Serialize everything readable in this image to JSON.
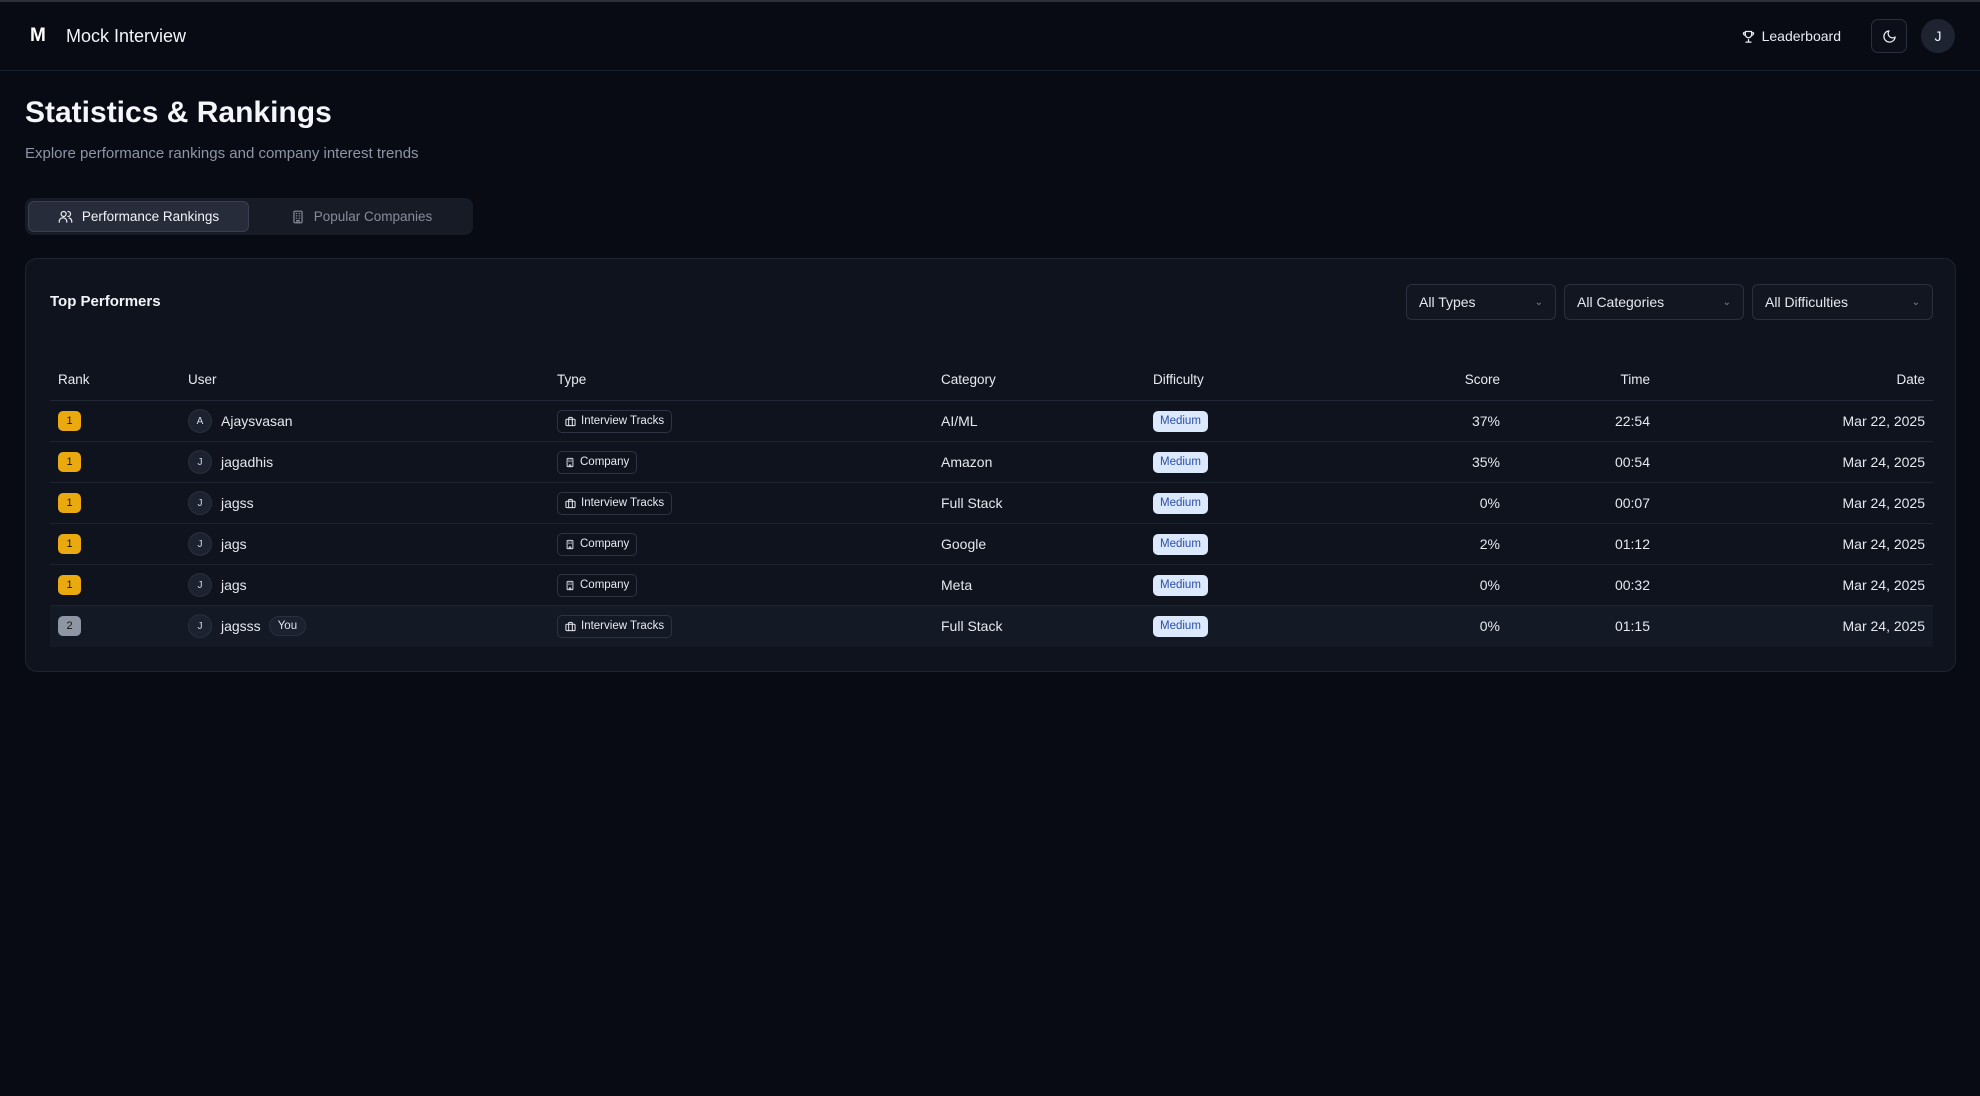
{
  "header": {
    "logo": "M",
    "app_title": "Mock Interview",
    "leaderboard_label": "Leaderboard",
    "avatar_initial": "J"
  },
  "page": {
    "title": "Statistics & Rankings",
    "subtitle": "Explore performance rankings and company interest trends"
  },
  "tabs": [
    {
      "label": "Performance Rankings",
      "active": true,
      "icon": "users-icon"
    },
    {
      "label": "Popular Companies",
      "active": false,
      "icon": "building-icon"
    }
  ],
  "card": {
    "title": "Top Performers",
    "filters": [
      "All Types",
      "All Categories",
      "All Difficulties"
    ]
  },
  "table": {
    "columns": [
      "Rank",
      "User",
      "Type",
      "Category",
      "Difficulty",
      "Score",
      "Time",
      "Date"
    ],
    "rows": [
      {
        "rank": "1",
        "initial": "A",
        "user": "Ajaysvasan",
        "you": "",
        "type": "Interview Tracks",
        "category": "AI/ML",
        "difficulty": "Medium",
        "score": "37%",
        "time": "22:54",
        "date": "Mar 22, 2025"
      },
      {
        "rank": "1",
        "initial": "J",
        "user": "jagadhis",
        "you": "",
        "type": "Company",
        "category": "Amazon",
        "difficulty": "Medium",
        "score": "35%",
        "time": "00:54",
        "date": "Mar 24, 2025"
      },
      {
        "rank": "1",
        "initial": "J",
        "user": "jagss",
        "you": "",
        "type": "Interview Tracks",
        "category": "Full Stack",
        "difficulty": "Medium",
        "score": "0%",
        "time": "00:07",
        "date": "Mar 24, 2025"
      },
      {
        "rank": "1",
        "initial": "J",
        "user": "jags",
        "you": "",
        "type": "Company",
        "category": "Google",
        "difficulty": "Medium",
        "score": "2%",
        "time": "01:12",
        "date": "Mar 24, 2025"
      },
      {
        "rank": "1",
        "initial": "J",
        "user": "jags",
        "you": "",
        "type": "Company",
        "category": "Meta",
        "difficulty": "Medium",
        "score": "0%",
        "time": "00:32",
        "date": "Mar 24, 2025"
      },
      {
        "rank": "2",
        "initial": "J",
        "user": "jagsss",
        "you": "You",
        "type": "Interview Tracks",
        "category": "Full Stack",
        "difficulty": "Medium",
        "score": "0%",
        "time": "01:15",
        "date": "Mar 24, 2025"
      }
    ]
  },
  "colors": {
    "rank_gold": "#e9a90f",
    "rank_silver": "#8e95a3",
    "difficulty_bg": "#dce8fb",
    "difficulty_text": "#2b4fa8"
  }
}
